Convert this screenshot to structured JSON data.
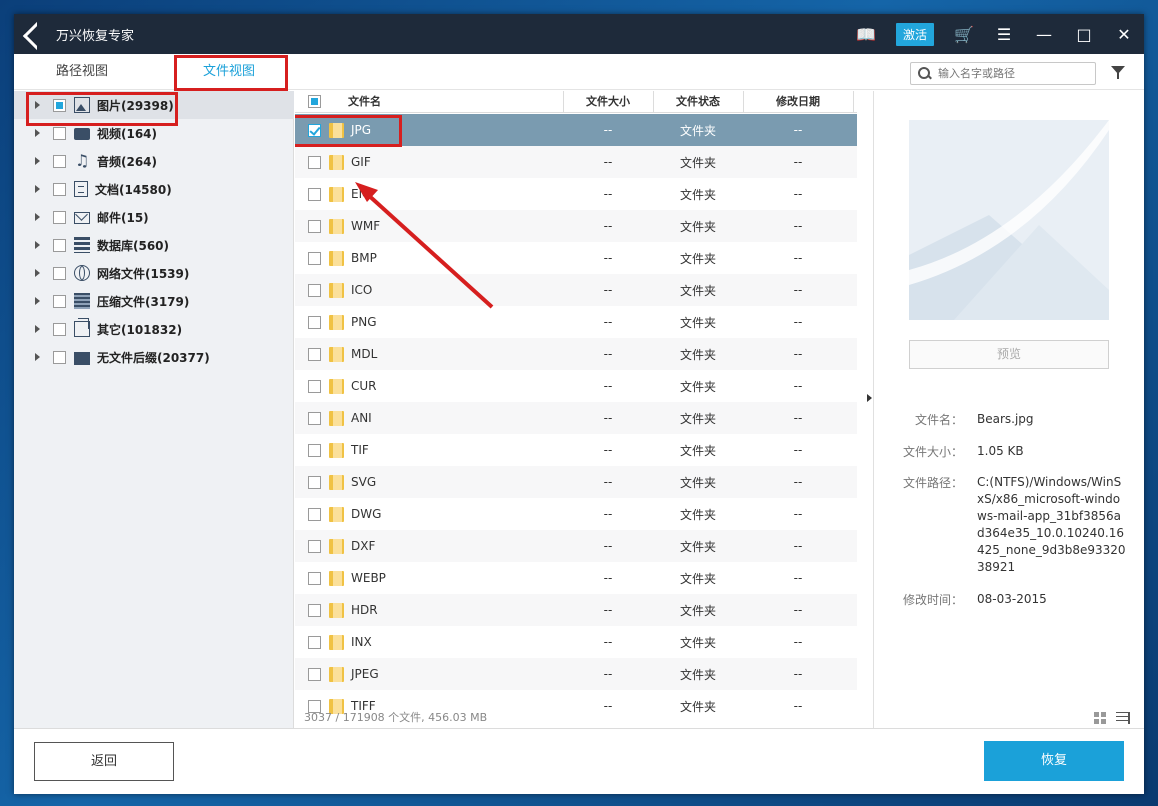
{
  "window": {
    "title": "万兴恢复专家",
    "activate_label": "激活"
  },
  "tabs": [
    {
      "label": "路径视图"
    },
    {
      "label": "文件视图"
    }
  ],
  "search": {
    "placeholder": "输入名字或路径"
  },
  "tree": {
    "items": [
      {
        "label": "图片(29398)",
        "icon": "image-icon",
        "state": "partial"
      },
      {
        "label": "视频(164)",
        "icon": "video-icon",
        "state": "none"
      },
      {
        "label": "音频(264)",
        "icon": "audio-icon",
        "state": "none"
      },
      {
        "label": "文档(14580)",
        "icon": "document-icon",
        "state": "none"
      },
      {
        "label": "邮件(15)",
        "icon": "mail-icon",
        "state": "none"
      },
      {
        "label": "数据库(560)",
        "icon": "database-icon",
        "state": "none"
      },
      {
        "label": "网络文件(1539)",
        "icon": "web-icon",
        "state": "none"
      },
      {
        "label": "压缩文件(3179)",
        "icon": "archive-icon",
        "state": "none"
      },
      {
        "label": "其它(101832)",
        "icon": "other-icon",
        "state": "none"
      },
      {
        "label": "无文件后缀(20377)",
        "icon": "noext-icon",
        "state": "none"
      }
    ]
  },
  "list": {
    "headers": {
      "name": "文件名",
      "size": "文件大小",
      "state": "文件状态",
      "date": "修改日期"
    },
    "rows": [
      {
        "name": "JPG",
        "size": "--",
        "state": "文件夹",
        "date": "--"
      },
      {
        "name": "GIF",
        "size": "--",
        "state": "文件夹",
        "date": "--"
      },
      {
        "name": "EMF",
        "size": "--",
        "state": "文件夹",
        "date": "--"
      },
      {
        "name": "WMF",
        "size": "--",
        "state": "文件夹",
        "date": "--"
      },
      {
        "name": "BMP",
        "size": "--",
        "state": "文件夹",
        "date": "--"
      },
      {
        "name": "ICO",
        "size": "--",
        "state": "文件夹",
        "date": "--"
      },
      {
        "name": "PNG",
        "size": "--",
        "state": "文件夹",
        "date": "--"
      },
      {
        "name": "MDL",
        "size": "--",
        "state": "文件夹",
        "date": "--"
      },
      {
        "name": "CUR",
        "size": "--",
        "state": "文件夹",
        "date": "--"
      },
      {
        "name": "ANI",
        "size": "--",
        "state": "文件夹",
        "date": "--"
      },
      {
        "name": "TIF",
        "size": "--",
        "state": "文件夹",
        "date": "--"
      },
      {
        "name": "SVG",
        "size": "--",
        "state": "文件夹",
        "date": "--"
      },
      {
        "name": "DWG",
        "size": "--",
        "state": "文件夹",
        "date": "--"
      },
      {
        "name": "DXF",
        "size": "--",
        "state": "文件夹",
        "date": "--"
      },
      {
        "name": "WEBP",
        "size": "--",
        "state": "文件夹",
        "date": "--"
      },
      {
        "name": "HDR",
        "size": "--",
        "state": "文件夹",
        "date": "--"
      },
      {
        "name": "INX",
        "size": "--",
        "state": "文件夹",
        "date": "--"
      },
      {
        "name": "JPEG",
        "size": "--",
        "state": "文件夹",
        "date": "--"
      },
      {
        "name": "TIFF",
        "size": "--",
        "state": "文件夹",
        "date": "--"
      }
    ],
    "status": "3037 / 171908 个文件, 456.03 MB"
  },
  "preview": {
    "button_label": "预览",
    "labels": {
      "name": "文件名：",
      "size": "文件大小：",
      "path": "文件路径：",
      "mtime": "修改时间："
    },
    "values": {
      "name": "Bears.jpg",
      "size": "1.05 KB",
      "path": "C:(NTFS)/Windows/WinSxS/x86_microsoft-windows-mail-app_31bf3856ad364e35_10.0.10240.16425_none_9d3b8e9332038921",
      "mtime": "08-03-2015"
    }
  },
  "footer": {
    "back_label": "返回",
    "recover_label": "恢复"
  },
  "colors": {
    "accent": "#1ba1d9",
    "annotation": "#d61f1f",
    "selected_row": "#7a9bb0"
  }
}
